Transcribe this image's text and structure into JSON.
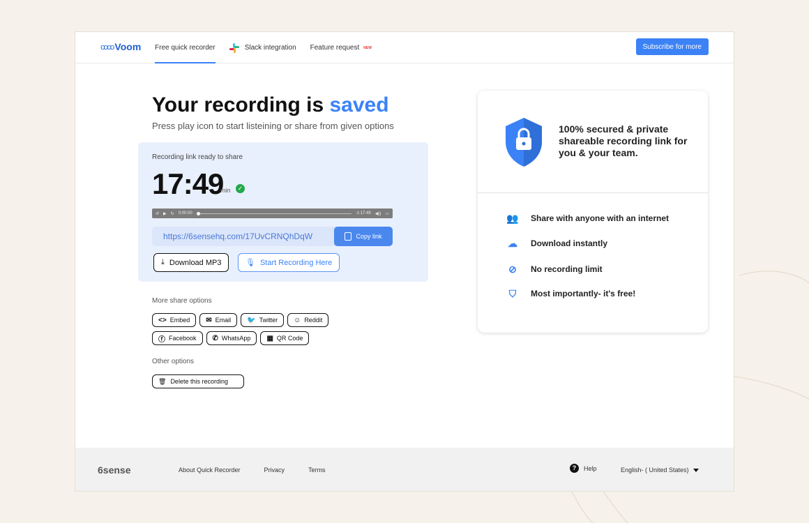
{
  "header": {
    "logo_mark": "ꝏꝏ",
    "logo_text": "Voom",
    "nav": [
      {
        "label": "Free quick recorder"
      },
      {
        "label": "Slack integration"
      },
      {
        "label": "Feature request",
        "badge": "NEW"
      }
    ],
    "subscribe_label": "Subscribe for more"
  },
  "main": {
    "title_prefix": "Your recording is ",
    "title_accent": "saved",
    "subtitle": "Press play icon to start listeining or share from given options",
    "recording": {
      "label": "Recording link ready to share",
      "duration": "17:49",
      "duration_unit": "min",
      "player": {
        "current_time": "0:00:00",
        "remaining_time": "-1:17:49"
      },
      "link": "https://6sensehq.com/17UvCRNQhDqW",
      "copy_label": "Copy link",
      "download_label": "Download MP3",
      "start_label": "Start Recording Here"
    },
    "more_share_label": "More share options",
    "share_row1": [
      {
        "icon": "embed-icon",
        "label": "Embed"
      },
      {
        "icon": "email-icon",
        "label": "Email"
      },
      {
        "icon": "twitter-icon",
        "label": "Twitter"
      },
      {
        "icon": "reddit-icon",
        "label": "Reddit"
      }
    ],
    "share_row2": [
      {
        "icon": "facebook-icon",
        "label": "Facebook"
      },
      {
        "icon": "whatsapp-icon",
        "label": "WhatsApp"
      },
      {
        "icon": "qr-code-icon",
        "label": "QR Code"
      }
    ],
    "other_options_label": "Other options",
    "delete_label": "Delete this recording"
  },
  "side": {
    "headline": "100% secured & private shareable recording link for you & your team.",
    "features": [
      {
        "icon": "users-icon",
        "label": "Share with anyone with an internet"
      },
      {
        "icon": "cloud-download-icon",
        "label": "Download instantly"
      },
      {
        "icon": "no-limit-icon",
        "label": "No recording limit"
      },
      {
        "icon": "shield-check-icon",
        "label": "Most importantly- it's free!"
      }
    ]
  },
  "footer": {
    "brand": "6sense",
    "links": [
      "About Quick Recorder",
      "Privacy",
      "Terms"
    ],
    "help_label": "Help",
    "language": "English- ( United States)"
  },
  "colors": {
    "accent": "#3b82f6",
    "background": "#f6f1ea",
    "verified": "#22a94a"
  }
}
